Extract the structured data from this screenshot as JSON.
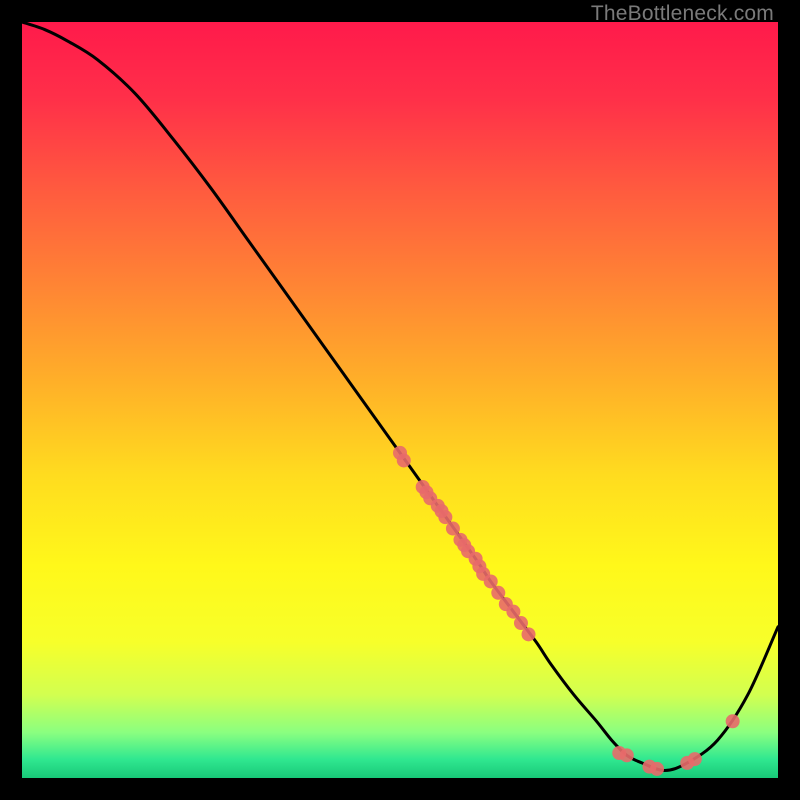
{
  "watermark": "TheBottleneck.com",
  "chart_data": {
    "type": "line",
    "title": "",
    "xlabel": "",
    "ylabel": "",
    "xlim": [
      0,
      100
    ],
    "ylim": [
      0,
      100
    ],
    "grid": false,
    "series": [
      {
        "name": "curve",
        "x": [
          0,
          3,
          6,
          10,
          15,
          20,
          25,
          30,
          35,
          40,
          45,
          50,
          55,
          60,
          62,
          65,
          68,
          70,
          73,
          76,
          78,
          80,
          82,
          85,
          88,
          92,
          96,
          100
        ],
        "y": [
          100,
          99,
          97.5,
          95,
          90.5,
          84.5,
          78,
          71,
          64,
          57,
          50,
          43,
          36,
          29,
          26,
          22,
          18,
          15,
          11,
          7.5,
          5,
          3,
          2,
          1,
          2,
          5,
          11,
          20
        ]
      }
    ],
    "scatter": {
      "name": "markers",
      "points": [
        {
          "x": 50,
          "y": 43
        },
        {
          "x": 50.5,
          "y": 42
        },
        {
          "x": 53,
          "y": 38.5
        },
        {
          "x": 53.5,
          "y": 37.8
        },
        {
          "x": 54,
          "y": 37
        },
        {
          "x": 55,
          "y": 36
        },
        {
          "x": 55.5,
          "y": 35.3
        },
        {
          "x": 56,
          "y": 34.5
        },
        {
          "x": 57,
          "y": 33
        },
        {
          "x": 58,
          "y": 31.5
        },
        {
          "x": 58.5,
          "y": 30.8
        },
        {
          "x": 59,
          "y": 30
        },
        {
          "x": 60,
          "y": 29
        },
        {
          "x": 60.5,
          "y": 28
        },
        {
          "x": 61,
          "y": 27
        },
        {
          "x": 62,
          "y": 26
        },
        {
          "x": 63,
          "y": 24.5
        },
        {
          "x": 64,
          "y": 23
        },
        {
          "x": 65,
          "y": 22
        },
        {
          "x": 66,
          "y": 20.5
        },
        {
          "x": 67,
          "y": 19
        },
        {
          "x": 79,
          "y": 3.3
        },
        {
          "x": 80,
          "y": 3
        },
        {
          "x": 83,
          "y": 1.5
        },
        {
          "x": 84,
          "y": 1.2
        },
        {
          "x": 88,
          "y": 2
        },
        {
          "x": 89,
          "y": 2.5
        },
        {
          "x": 94,
          "y": 7.5
        }
      ]
    },
    "gradient_stops": [
      {
        "offset": 0.0,
        "color": "#ff1a4b"
      },
      {
        "offset": 0.1,
        "color": "#ff2f49"
      },
      {
        "offset": 0.22,
        "color": "#ff5a3f"
      },
      {
        "offset": 0.35,
        "color": "#ff8534"
      },
      {
        "offset": 0.48,
        "color": "#ffb128"
      },
      {
        "offset": 0.6,
        "color": "#ffdc1f"
      },
      {
        "offset": 0.72,
        "color": "#fff81a"
      },
      {
        "offset": 0.82,
        "color": "#f7ff2a"
      },
      {
        "offset": 0.89,
        "color": "#d2ff50"
      },
      {
        "offset": 0.94,
        "color": "#8aff80"
      },
      {
        "offset": 0.975,
        "color": "#30e890"
      },
      {
        "offset": 1.0,
        "color": "#18c878"
      }
    ],
    "marker_color": "#e86a6a",
    "curve_color": "#000000"
  }
}
